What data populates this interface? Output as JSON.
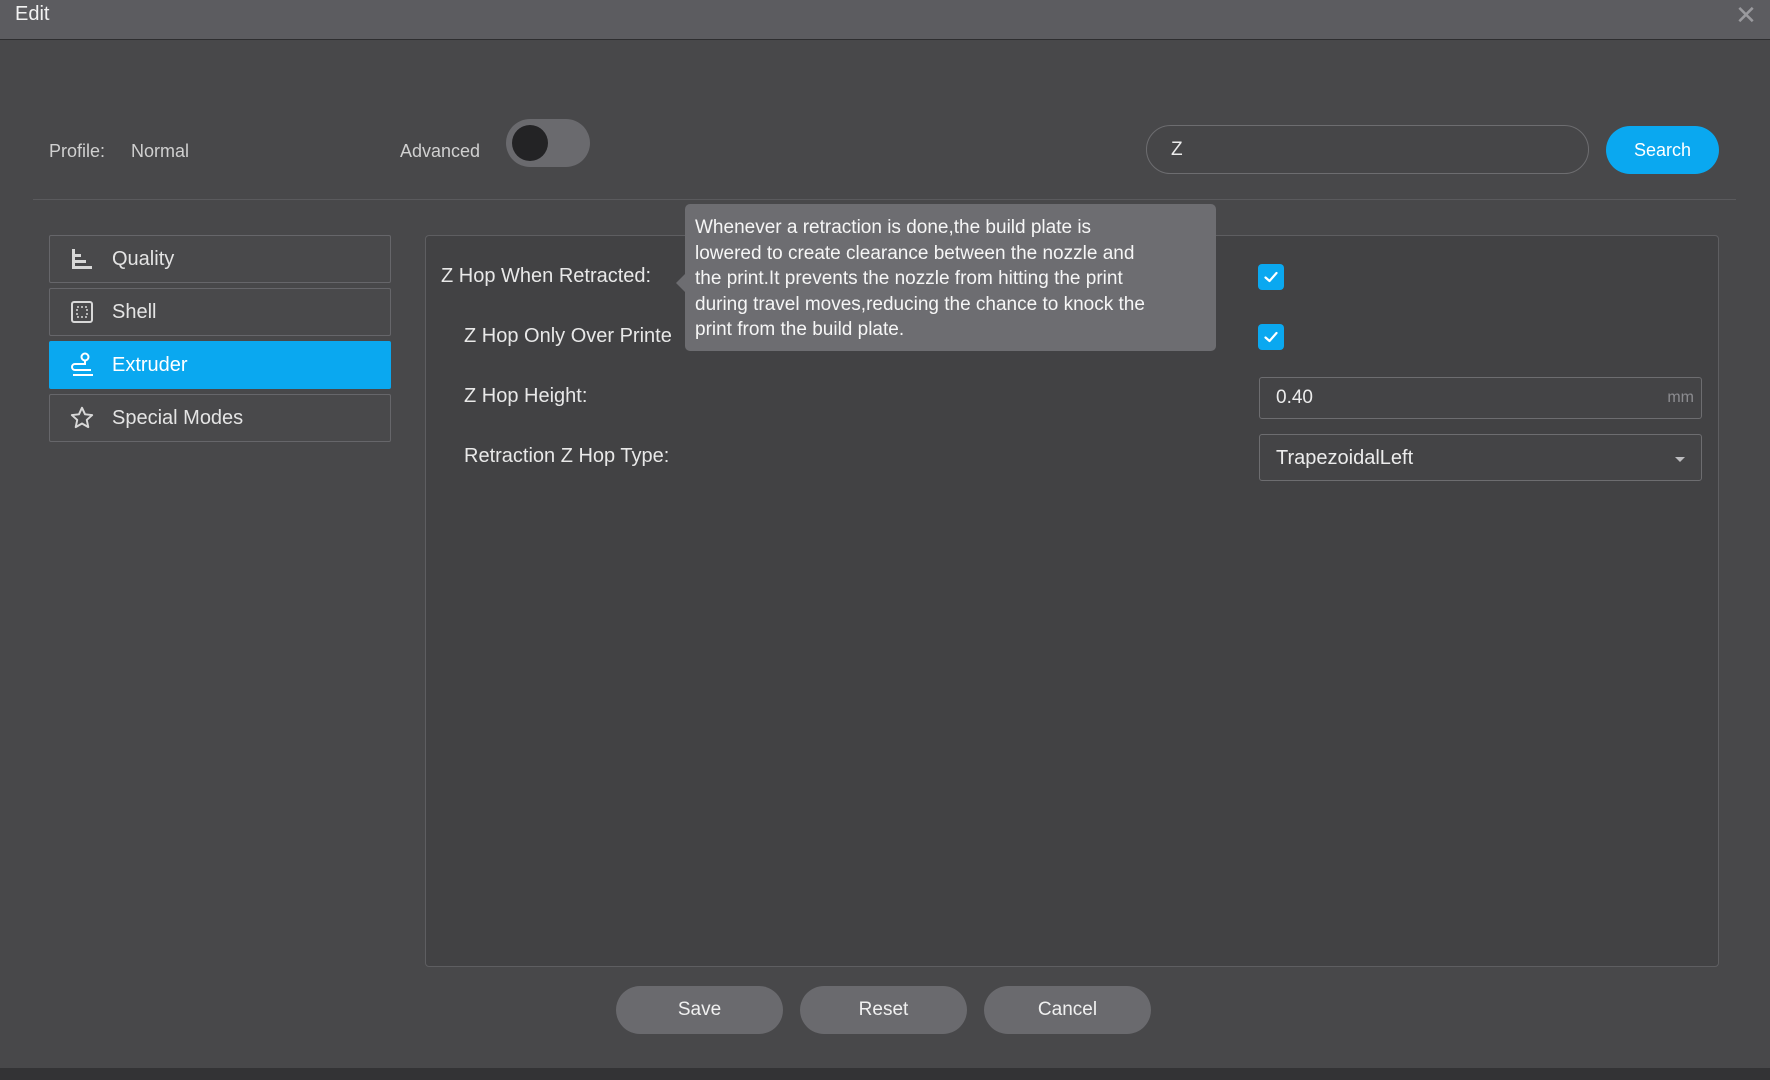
{
  "window": {
    "title": "Edit",
    "close_icon": "close-icon"
  },
  "header": {
    "profile_label": "Profile:",
    "profile_value": "Normal",
    "advanced_label": "Advanced",
    "advanced_enabled": false
  },
  "search": {
    "value": "Z",
    "button_label": "Search"
  },
  "sidebar": {
    "items": [
      {
        "label": "Quality",
        "icon": "quality-icon",
        "active": false
      },
      {
        "label": "Shell",
        "icon": "shell-icon",
        "active": false
      },
      {
        "label": "Extruder",
        "icon": "extruder-icon",
        "active": true
      },
      {
        "label": "Special Modes",
        "icon": "star-icon",
        "active": false
      }
    ]
  },
  "settings": {
    "z_hop_when_retracted": {
      "label": "Z Hop When Retracted:",
      "checked": true
    },
    "z_hop_only_over_printed": {
      "label": "Z Hop Only Over Printe",
      "checked": true
    },
    "z_hop_height": {
      "label": "Z Hop Height:",
      "value": "0.40",
      "unit": "mm"
    },
    "retraction_z_hop_type": {
      "label": "Retraction Z Hop Type:",
      "value": "TrapezoidalLeft"
    }
  },
  "tooltip": {
    "lines": [
      "Whenever a retraction is done,the build plate is",
      "lowered to create clearance between the nozzle and",
      "the print.It prevents the nozzle from hitting the print",
      "during travel moves,reducing the chance to knock the",
      "print from the build plate."
    ]
  },
  "footer": {
    "save_label": "Save",
    "reset_label": "Reset",
    "cancel_label": "Cancel"
  },
  "colors": {
    "accent": "#0aa8f0",
    "background": "#48484a",
    "titlebar": "#5c5c60",
    "tooltip": "#6d6d71"
  }
}
